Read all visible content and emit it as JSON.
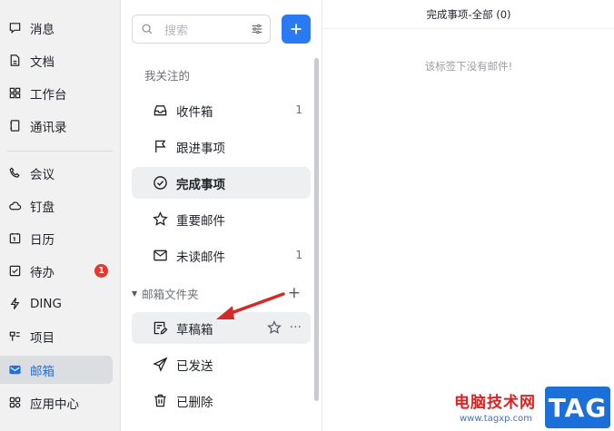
{
  "nav": {
    "items": [
      {
        "label": "消息",
        "icon": "message-icon"
      },
      {
        "label": "文档",
        "icon": "document-icon"
      },
      {
        "label": "工作台",
        "icon": "workbench-icon"
      },
      {
        "label": "通讯录",
        "icon": "contacts-icon"
      },
      {
        "label": "会议",
        "icon": "phone-icon"
      },
      {
        "label": "钉盘",
        "icon": "cloud-icon"
      },
      {
        "label": "日历",
        "icon": "calendar-icon"
      },
      {
        "label": "待办",
        "icon": "todo-check-icon",
        "badge": "1"
      },
      {
        "label": "DING",
        "icon": "lightning-icon"
      },
      {
        "label": "项目",
        "icon": "project-icon"
      },
      {
        "label": "邮箱",
        "icon": "mail-icon",
        "active": true
      },
      {
        "label": "应用中心",
        "icon": "apps-icon"
      }
    ]
  },
  "folders_panel": {
    "search_placeholder": "搜索",
    "section_label": "我关注的",
    "favorites": [
      {
        "label": "收件箱",
        "icon": "inbox-icon",
        "count": "1"
      },
      {
        "label": "跟进事项",
        "icon": "flag-icon",
        "count": ""
      },
      {
        "label": "完成事项",
        "icon": "check-circle-icon",
        "count": "",
        "selected": true
      },
      {
        "label": "重要邮件",
        "icon": "star-icon",
        "count": ""
      },
      {
        "label": "未读邮件",
        "icon": "envelope-icon",
        "count": "1"
      }
    ],
    "mailbox_group_label": "邮箱文件夹",
    "mailbox_folders": [
      {
        "label": "草稿箱",
        "icon": "draft-edit-icon",
        "hover": true
      },
      {
        "label": "已发送",
        "icon": "send-icon"
      },
      {
        "label": "已删除",
        "icon": "trash-icon"
      }
    ],
    "more_symbol": "···",
    "add_symbol": "+"
  },
  "content": {
    "title": "完成事项-全部 (0)",
    "empty_text": "该标签下没有邮件!"
  },
  "watermark": {
    "cn_text": "电脑技术网",
    "url": "www.tagxp.com",
    "tag": "TAG"
  },
  "colors": {
    "accent": "#2a7af3",
    "badge_red": "#e8362f",
    "arrow_red": "#d42a2a"
  }
}
